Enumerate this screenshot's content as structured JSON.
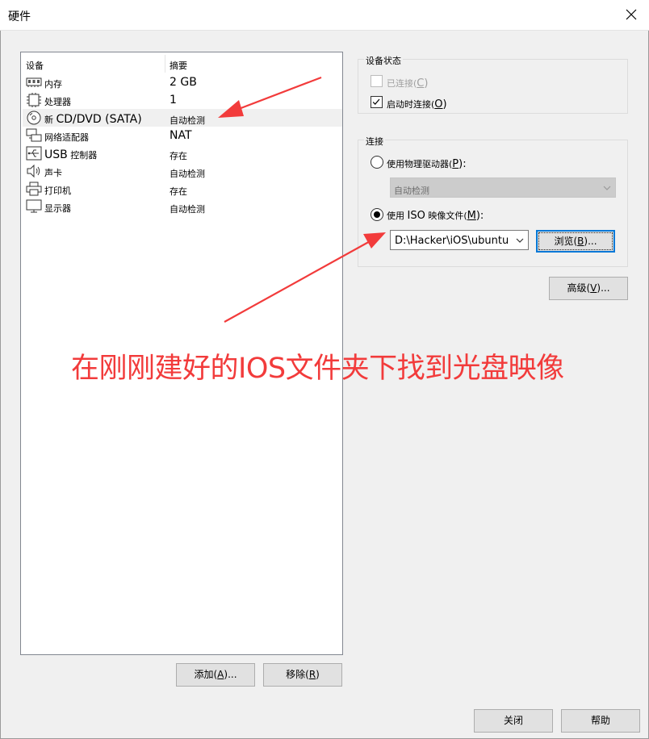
{
  "window": {
    "title": "硬件"
  },
  "device_list": {
    "col_device": "设备",
    "col_summary": "摘要",
    "rows": [
      {
        "icon": "memory-icon",
        "name": "内存",
        "summary": "2 GB"
      },
      {
        "icon": "processor-icon",
        "name": "处理器",
        "summary": "1"
      },
      {
        "icon": "cd-dvd-icon",
        "name_prefix": "新",
        "name": "CD/DVD (SATA)",
        "summary": "自动检测"
      },
      {
        "icon": "network-adapter-icon",
        "name": "网络适配器",
        "summary": "NAT"
      },
      {
        "icon": "usb-icon",
        "name_prefix": "USB",
        "name": "控制器",
        "summary": "存在"
      },
      {
        "icon": "speaker-icon",
        "name": "声卡",
        "summary": "自动检测"
      },
      {
        "icon": "printer-icon",
        "name": "打印机",
        "summary": "存在"
      },
      {
        "icon": "monitor-icon",
        "name": "显示器",
        "summary": "自动检测"
      }
    ]
  },
  "list_buttons": {
    "add": {
      "label": "添加(",
      "key": "A",
      "suffix": ")..."
    },
    "remove": {
      "label": "移除(",
      "key": "R",
      "suffix": ")"
    }
  },
  "device_status": {
    "legend": "设备状态",
    "connected": {
      "label": "已连接(",
      "key": "C",
      "suffix": ")",
      "checked": false,
      "enabled": false
    },
    "connect_at_power_on": {
      "label": "启动时连接(",
      "key": "O",
      "suffix": ")",
      "checked": true
    }
  },
  "connection": {
    "legend": "连接",
    "physical": {
      "label": "使用物理驱动器(",
      "key": "P",
      "suffix": "):",
      "selected": false
    },
    "physical_drive_value": "自动检测",
    "iso": {
      "label_a": "使用",
      "label_iso": "ISO",
      "label_b": "映像文件(",
      "key": "M",
      "suffix": "):",
      "selected": true
    },
    "iso_path": "D:\\Hacker\\iOS\\ubuntu",
    "browse": {
      "label": "浏览(",
      "key": "B",
      "suffix": ")..."
    }
  },
  "advanced": {
    "label": "高级(",
    "key": "V",
    "suffix": ")..."
  },
  "annotation": {
    "text": "在刚刚建好的IOS文件夹下找到光盘映像",
    "color": "#f23b3b"
  },
  "footer": {
    "close": "关闭",
    "help": "帮助"
  }
}
